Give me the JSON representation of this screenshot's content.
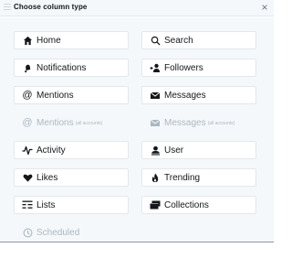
{
  "dialog": {
    "title": "Choose column type",
    "close_glyph": "×"
  },
  "options": [
    {
      "label": "Home",
      "icon": "home-icon",
      "enabled": true
    },
    {
      "label": "Search",
      "icon": "search-icon",
      "enabled": true
    },
    {
      "label": "Notifications",
      "icon": "bell-icon",
      "enabled": true
    },
    {
      "label": "Followers",
      "icon": "follower-add-icon",
      "enabled": true
    },
    {
      "label": "Mentions",
      "icon": "at-icon",
      "enabled": true
    },
    {
      "label": "Messages",
      "icon": "messages-icon",
      "enabled": true
    },
    {
      "label": "Mentions",
      "sub": "(all accounts)",
      "icon": "at-icon",
      "enabled": false
    },
    {
      "label": "Messages",
      "sub": "(all accounts)",
      "icon": "messages-icon",
      "enabled": false
    },
    {
      "label": "Activity",
      "icon": "activity-icon",
      "enabled": true
    },
    {
      "label": "User",
      "icon": "user-icon",
      "enabled": true
    },
    {
      "label": "Likes",
      "icon": "heart-icon",
      "enabled": true
    },
    {
      "label": "Trending",
      "icon": "flame-icon",
      "enabled": true
    },
    {
      "label": "Lists",
      "icon": "list-icon",
      "enabled": true
    },
    {
      "label": "Collections",
      "icon": "collection-icon",
      "enabled": true
    },
    {
      "label": "Scheduled",
      "icon": "clock-icon",
      "enabled": false
    }
  ],
  "colors": {
    "text": "#14171a",
    "disabled": "#aab8c2",
    "border": "#e1e8ed",
    "panel": "#f5f8fa"
  }
}
